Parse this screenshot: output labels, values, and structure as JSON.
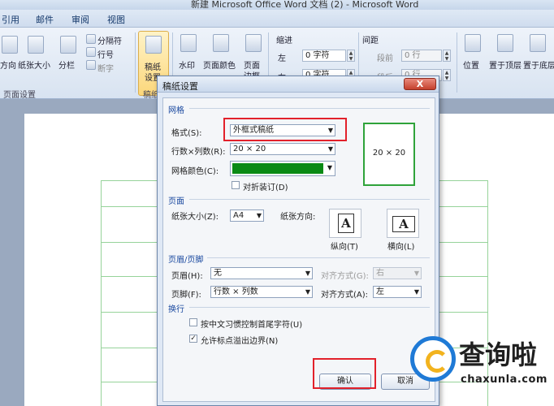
{
  "window": {
    "title": "新建 Microsoft Office Word 文档 (2) - Microsoft Word"
  },
  "tabs": [
    "引用",
    "邮件",
    "审阅",
    "视图"
  ],
  "ribbon": {
    "page_setup": {
      "direction": "方向",
      "paper_size": "纸张大小",
      "columns": "分栏",
      "breaks": "分隔符",
      "line_numbers": "行号",
      "hyphenation": "断字",
      "group_label": "页面设置"
    },
    "manuscript": {
      "label_line1": "稿纸",
      "label_line2": "设置",
      "group_label": "稿纸"
    },
    "background": {
      "watermark": "水印",
      "page_color": "页面颜色",
      "page_border_1": "页面",
      "page_border_2": "边框"
    },
    "paragraph": {
      "indent_title": "缩进",
      "indent_left": "左",
      "indent_left_value": "0 字符",
      "indent_right": "右",
      "indent_right_value": "0 字符",
      "spacing_title": "间距",
      "spacing_before": "段前",
      "spacing_before_value": "0 行",
      "spacing_after": "段后",
      "spacing_after_value": "0 行"
    },
    "arrange": {
      "position": "位置",
      "bring_front": "置于顶层",
      "send_back": "置于底层"
    }
  },
  "dialog": {
    "title": "稿纸设置",
    "close": "X",
    "grid": {
      "section": "网格",
      "style_label": "格式(S):",
      "style_value": "外框式稿纸",
      "rowscols_label": "行数×列数(R):",
      "rowscols_value": "20 × 20",
      "color_label": "网格颜色(C):",
      "color_value": "#0a8a14",
      "fold_checkbox": "对折装订(D)",
      "fold_checked": false,
      "preview_text": "20 × 20"
    },
    "page": {
      "section": "页面",
      "size_label": "纸张大小(Z):",
      "size_value": "A4",
      "orientation_label": "纸张方向:",
      "portrait": "纵向(T)",
      "landscape": "横向(L)"
    },
    "header_footer": {
      "section": "页眉/页脚",
      "header_label": "页眉(H):",
      "header_value": "无",
      "header_align_label": "对齐方式(G):",
      "header_align_value": "右",
      "footer_label": "页脚(F):",
      "footer_value": "行数 × 列数",
      "footer_align_label": "对齐方式(A):",
      "footer_align_value": "左"
    },
    "wrap": {
      "section": "换行",
      "chinese_rule": "按中文习惯控制首尾字符(U)",
      "chinese_rule_checked": false,
      "punct_overflow": "允许标点溢出边界(N)",
      "punct_overflow_checked": true
    },
    "ok": "确认",
    "cancel": "取消"
  },
  "watermark": {
    "cn": "查询啦",
    "en": "chaxunla.com"
  },
  "colors": {
    "highlight": "#e2212b",
    "grid_line": "#96d39a",
    "brand_blue": "#1f7ad6",
    "brand_yellow": "#f2b31e"
  }
}
